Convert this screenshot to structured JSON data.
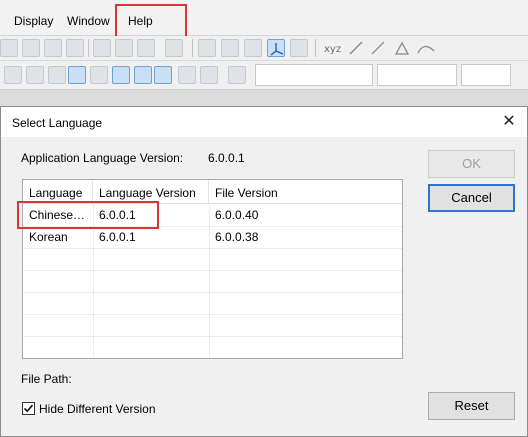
{
  "menubar": {
    "items": [
      {
        "label": "Display"
      },
      {
        "label": "Window"
      },
      {
        "label": "Help"
      }
    ]
  },
  "toolbar": {
    "xyz_label": "xyz"
  },
  "dialog": {
    "title": "Select Language",
    "close_glyph": "✕",
    "app_version_label": "Application Language Version:",
    "app_version_value": "6.0.0.1",
    "ok_label": "OK",
    "cancel_label": "Cancel",
    "reset_label": "Reset",
    "file_path_label": "File Path:",
    "hide_different_label": "Hide Different Version",
    "hide_different_checked": true,
    "columns": [
      "Language",
      "Language Version",
      "File Version"
    ],
    "rows": [
      {
        "language": "Chinese…",
        "language_version": "6.0.0.1",
        "file_version": "6.0.0.40"
      },
      {
        "language": "Korean",
        "language_version": "6.0.0.1",
        "file_version": "6.0.0.38"
      }
    ]
  },
  "colors": {
    "highlight": "#d9343a",
    "default_button_border": "#2f74c9"
  }
}
